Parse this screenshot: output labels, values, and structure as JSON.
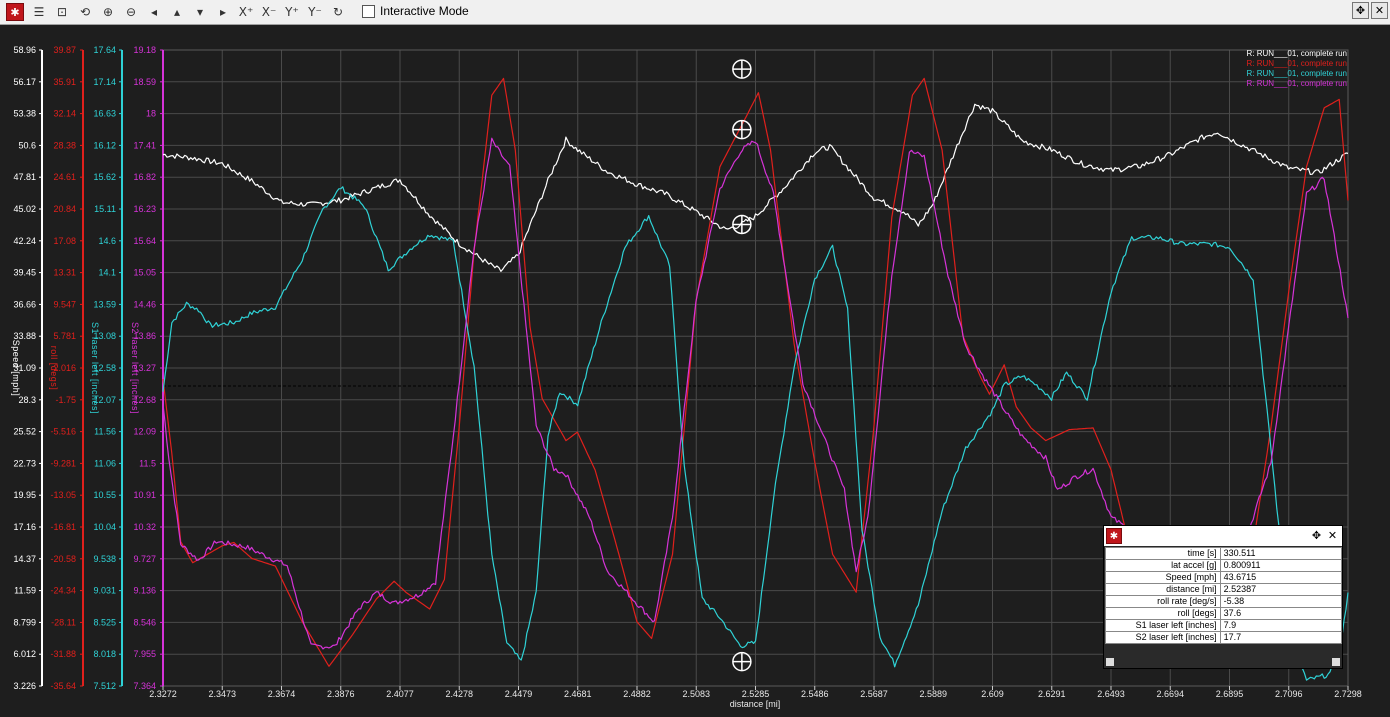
{
  "toolbar": {
    "interactive_mode_label": "Interactive Mode",
    "buttons": [
      "settings-icon",
      "checklist-icon",
      "zoom-window-icon",
      "zoom-fit-icon",
      "zoom-in-icon",
      "zoom-out-icon",
      "pan-left-icon",
      "pan-up-icon",
      "pan-down-icon",
      "pan-right-icon",
      "add-x-cursor-icon",
      "remove-x-cursor-icon",
      "add-y-cursor-icon",
      "remove-y-cursor-icon",
      "refresh-icon"
    ]
  },
  "colors": {
    "speed": "#ffffff",
    "roll": "#e0201c",
    "s1": "#2fd2d6",
    "s2": "#d633d8",
    "grid": "#4a4a4a",
    "bg": "#1e1e1e"
  },
  "chart_data": {
    "type": "line",
    "xlabel": "distance [mi]",
    "x_ticks": [
      "2.3272",
      "2.3473",
      "2.3674",
      "2.3876",
      "2.4077",
      "2.4278",
      "2.4479",
      "2.4681",
      "2.4882",
      "2.5083",
      "2.5285",
      "2.5486",
      "2.5687",
      "2.5889",
      "2.609",
      "2.6291",
      "2.6493",
      "2.6694",
      "2.6895",
      "2.7096",
      "2.7298"
    ],
    "xlim": [
      2.3272,
      2.7298
    ],
    "cursor_x": 2.52387,
    "legend": [
      "R:  RUN___01, complete run",
      "R:  RUN___01, complete run",
      "R:  RUN___01, complete run",
      "R:  RUN___01, complete run"
    ],
    "axes": [
      {
        "id": "speed",
        "label": "Speed [mph]",
        "ylim": [
          3.226,
          58.96
        ],
        "ticks": [
          "58.96",
          "56.17",
          "53.38",
          "50.6",
          "47.81",
          "45.02",
          "42.24",
          "39.45",
          "36.66",
          "33.88",
          "31.09",
          "28.3",
          "25.52",
          "22.73",
          "19.95",
          "17.16",
          "14.37",
          "11.59",
          "8.799",
          "6.012",
          "3.226"
        ]
      },
      {
        "id": "roll",
        "label": "roll [degs]",
        "ylim": [
          -35.64,
          39.87
        ],
        "ticks": [
          "39.87",
          "35.91",
          "32.14",
          "28.38",
          "24.61",
          "20.84",
          "17.08",
          "13.31",
          "9.547",
          "5.781",
          "2.016",
          "-1.75",
          "-5.516",
          "-9.281",
          "-13.05",
          "-16.81",
          "-20.58",
          "-24.34",
          "-28.11",
          "-31.88",
          "-35.64"
        ]
      },
      {
        "id": "s1",
        "label": "S1 laser left [inches]",
        "ylim": [
          7.512,
          17.64
        ],
        "ticks": [
          "17.64",
          "17.14",
          "16.63",
          "16.12",
          "15.62",
          "15.11",
          "14.6",
          "14.1",
          "13.59",
          "13.08",
          "12.58",
          "12.07",
          "11.56",
          "11.06",
          "10.55",
          "10.04",
          "9.538",
          "9.031",
          "8.525",
          "8.018",
          "7.512"
        ]
      },
      {
        "id": "s2",
        "label": "S2 laser left [inches]",
        "ylim": [
          7.364,
          19.18
        ],
        "ticks": [
          "19.18",
          "18.59",
          "18",
          "17.41",
          "16.82",
          "16.23",
          "15.64",
          "15.05",
          "14.46",
          "13.86",
          "13.27",
          "12.68",
          "12.09",
          "11.5",
          "10.91",
          "10.32",
          "9.727",
          "9.136",
          "8.546",
          "7.955",
          "7.364"
        ]
      }
    ],
    "series": [
      {
        "name": "Speed [mph]",
        "axis": "speed",
        "noise": 0.25,
        "points": [
          [
            2.3272,
            49.8
          ],
          [
            2.3373,
            49.5
          ],
          [
            2.3473,
            49.0
          ],
          [
            2.3573,
            47.5
          ],
          [
            2.3674,
            45.6
          ],
          [
            2.3775,
            45.4
          ],
          [
            2.3876,
            45.8
          ],
          [
            2.4077,
            47.6
          ],
          [
            2.4178,
            44.5
          ],
          [
            2.4278,
            42.0
          ],
          [
            2.4379,
            40.2
          ],
          [
            2.442,
            39.6
          ],
          [
            2.4479,
            41.0
          ],
          [
            2.458,
            47.5
          ],
          [
            2.4641,
            51.1
          ],
          [
            2.4681,
            50.2
          ],
          [
            2.4782,
            48.3
          ],
          [
            2.4882,
            47.2
          ],
          [
            2.4983,
            46.3
          ],
          [
            2.5083,
            44.8
          ],
          [
            2.5184,
            43.2
          ],
          [
            2.5239,
            43.7
          ],
          [
            2.5285,
            44.4
          ],
          [
            2.5386,
            47.0
          ],
          [
            2.5486,
            50.0
          ],
          [
            2.5537,
            50.5
          ],
          [
            2.5587,
            49.0
          ],
          [
            2.5687,
            46.0
          ],
          [
            2.5788,
            44.8
          ],
          [
            2.5838,
            43.6
          ],
          [
            2.5889,
            45.5
          ],
          [
            2.599,
            51.8
          ],
          [
            2.603,
            54.2
          ],
          [
            2.609,
            53.6
          ],
          [
            2.6191,
            51.0
          ],
          [
            2.6291,
            50.2
          ],
          [
            2.6392,
            49.0
          ],
          [
            2.6493,
            48.4
          ],
          [
            2.6593,
            48.8
          ],
          [
            2.6694,
            49.8
          ],
          [
            2.6795,
            51.2
          ],
          [
            2.6855,
            51.8
          ],
          [
            2.6895,
            51.2
          ],
          [
            2.7096,
            48.6
          ],
          [
            2.7197,
            48.2
          ],
          [
            2.7298,
            49.9
          ]
        ]
      },
      {
        "name": "roll [degs]",
        "axis": "roll",
        "noise": 0,
        "points": [
          [
            2.3272,
            0.8
          ],
          [
            2.3302,
            -8
          ],
          [
            2.3332,
            -18.5
          ],
          [
            2.3373,
            -21.0
          ],
          [
            2.3473,
            -19.0
          ],
          [
            2.3513,
            -18.6
          ],
          [
            2.3574,
            -20.5
          ],
          [
            2.3654,
            -21.4
          ],
          [
            2.3745,
            -28.0
          ],
          [
            2.3836,
            -33.3
          ],
          [
            2.3917,
            -29.5
          ],
          [
            2.3997,
            -25.3
          ],
          [
            2.4057,
            -23.2
          ],
          [
            2.4097,
            -24.5
          ],
          [
            2.4178,
            -26.5
          ],
          [
            2.4228,
            -23.0
          ],
          [
            2.4278,
            -5.0
          ],
          [
            2.4329,
            16.0
          ],
          [
            2.4389,
            34.5
          ],
          [
            2.4429,
            36.5
          ],
          [
            2.4469,
            28.0
          ],
          [
            2.4519,
            7.0
          ],
          [
            2.456,
            -1.5
          ],
          [
            2.4641,
            -6.5
          ],
          [
            2.468,
            -5.5
          ],
          [
            2.474,
            -10.0
          ],
          [
            2.4821,
            -20.0
          ],
          [
            2.4882,
            -28.0
          ],
          [
            2.4932,
            -30.0
          ],
          [
            2.5003,
            -20.0
          ],
          [
            2.5083,
            10.0
          ],
          [
            2.5164,
            26.0
          ],
          [
            2.5254,
            32.0
          ],
          [
            2.5295,
            34.8
          ],
          [
            2.5336,
            28.0
          ],
          [
            2.5416,
            5.0
          ],
          [
            2.5486,
            -9.0
          ],
          [
            2.5547,
            -20.0
          ],
          [
            2.5627,
            -24.5
          ],
          [
            2.5687,
            -5.0
          ],
          [
            2.5748,
            20.0
          ],
          [
            2.5818,
            34.5
          ],
          [
            2.5858,
            36.5
          ],
          [
            2.5919,
            28.0
          ],
          [
            2.5989,
            6.0
          ],
          [
            2.605,
            1.0
          ],
          [
            2.608,
            -1.0
          ],
          [
            2.613,
            2.5
          ],
          [
            2.6171,
            -2.5
          ],
          [
            2.6221,
            -5.0
          ],
          [
            2.6271,
            -6.5
          ],
          [
            2.6351,
            -5.2
          ],
          [
            2.6432,
            -5.0
          ],
          [
            2.6493,
            -10.0
          ],
          [
            2.6573,
            -21.5
          ],
          [
            2.6674,
            -28.0
          ],
          [
            2.6775,
            -32.0
          ],
          [
            2.6855,
            -33.0
          ],
          [
            2.6936,
            -28.0
          ],
          [
            2.7036,
            -5.0
          ],
          [
            2.7096,
            11.0
          ],
          [
            2.7157,
            26.0
          ],
          [
            2.7217,
            33.0
          ],
          [
            2.7268,
            34.0
          ],
          [
            2.7298,
            22.0
          ]
        ]
      },
      {
        "name": "S1 laser left [inches]",
        "axis": "s1",
        "noise": 0.04,
        "points": [
          [
            2.3272,
            12.2
          ],
          [
            2.3302,
            13.3
          ],
          [
            2.3352,
            13.6
          ],
          [
            2.3393,
            13.5
          ],
          [
            2.3433,
            13.25
          ],
          [
            2.3513,
            13.3
          ],
          [
            2.3574,
            13.45
          ],
          [
            2.3654,
            13.55
          ],
          [
            2.3745,
            14.3
          ],
          [
            2.3815,
            15.1
          ],
          [
            2.3876,
            15.45
          ],
          [
            2.3957,
            15.15
          ],
          [
            2.4037,
            14.15
          ],
          [
            2.4118,
            14.5
          ],
          [
            2.4178,
            14.7
          ],
          [
            2.4258,
            14.6
          ],
          [
            2.4329,
            12.6
          ],
          [
            2.4389,
            9.6
          ],
          [
            2.444,
            8.2
          ],
          [
            2.4489,
            7.9
          ],
          [
            2.454,
            9.0
          ],
          [
            2.458,
            11.5
          ],
          [
            2.462,
            12.2
          ],
          [
            2.4681,
            12.0
          ],
          [
            2.4761,
            13.3
          ],
          [
            2.4842,
            14.5
          ],
          [
            2.4922,
            15.0
          ],
          [
            2.4993,
            14.2
          ],
          [
            2.5043,
            11.0
          ],
          [
            2.5104,
            8.9
          ],
          [
            2.5164,
            8.6
          ],
          [
            2.5234,
            8.15
          ],
          [
            2.5285,
            8.2
          ],
          [
            2.5346,
            10.5
          ],
          [
            2.5416,
            12.6
          ],
          [
            2.5486,
            14.0
          ],
          [
            2.5547,
            14.5
          ],
          [
            2.5598,
            13.5
          ],
          [
            2.5647,
            10.0
          ],
          [
            2.5708,
            8.3
          ],
          [
            2.5758,
            7.85
          ],
          [
            2.5838,
            8.8
          ],
          [
            2.5919,
            10.3
          ],
          [
            2.5999,
            11.3
          ],
          [
            2.609,
            11.9
          ],
          [
            2.613,
            12.3
          ],
          [
            2.6191,
            12.45
          ],
          [
            2.6241,
            12.3
          ],
          [
            2.6291,
            12.1
          ],
          [
            2.6342,
            12.5
          ],
          [
            2.6412,
            12.1
          ],
          [
            2.6493,
            13.8
          ],
          [
            2.6563,
            14.65
          ],
          [
            2.6654,
            14.65
          ],
          [
            2.6734,
            14.55
          ],
          [
            2.6835,
            14.55
          ],
          [
            2.6896,
            14.5
          ],
          [
            2.6976,
            14.0
          ],
          [
            2.7036,
            11.3
          ],
          [
            2.7096,
            8.5
          ],
          [
            2.7157,
            7.6
          ],
          [
            2.7237,
            7.7
          ],
          [
            2.7278,
            8.3
          ],
          [
            2.7298,
            9.0
          ]
        ]
      },
      {
        "name": "S2 laser left [inches]",
        "axis": "s2",
        "noise": 0.05,
        "points": [
          [
            2.3272,
            12.6
          ],
          [
            2.3292,
            11.6
          ],
          [
            2.3332,
            10.0
          ],
          [
            2.3393,
            9.7
          ],
          [
            2.3453,
            10.05
          ],
          [
            2.3553,
            9.95
          ],
          [
            2.3614,
            9.8
          ],
          [
            2.3694,
            9.6
          ],
          [
            2.3775,
            8.1
          ],
          [
            2.3856,
            8.1
          ],
          [
            2.3937,
            8.8
          ],
          [
            2.3997,
            9.1
          ],
          [
            2.4057,
            8.9
          ],
          [
            2.4138,
            9.05
          ],
          [
            2.4198,
            9.3
          ],
          [
            2.4258,
            12.0
          ],
          [
            2.4329,
            15.5
          ],
          [
            2.4389,
            17.5
          ],
          [
            2.445,
            17.0
          ],
          [
            2.454,
            12.2
          ],
          [
            2.46,
            11.4
          ],
          [
            2.4641,
            11.3
          ],
          [
            2.4721,
            10.5
          ],
          [
            2.4782,
            9.5
          ],
          [
            2.4882,
            8.9
          ],
          [
            2.4942,
            8.55
          ],
          [
            2.5003,
            10.5
          ],
          [
            2.5083,
            14.5
          ],
          [
            2.5164,
            16.6
          ],
          [
            2.5234,
            17.3
          ],
          [
            2.5285,
            17.5
          ],
          [
            2.5346,
            16.5
          ],
          [
            2.5446,
            13.0
          ],
          [
            2.5516,
            12.0
          ],
          [
            2.5587,
            11.0
          ],
          [
            2.5627,
            9.5
          ],
          [
            2.5667,
            10.5
          ],
          [
            2.5748,
            15.0
          ],
          [
            2.5808,
            17.3
          ],
          [
            2.5858,
            17.2
          ],
          [
            2.5939,
            15.0
          ],
          [
            2.5999,
            13.7
          ],
          [
            2.605,
            13.2
          ],
          [
            2.613,
            12.5
          ],
          [
            2.6191,
            12.0
          ],
          [
            2.6271,
            11.6
          ],
          [
            2.6311,
            11.0
          ],
          [
            2.6372,
            11.25
          ],
          [
            2.6432,
            11.4
          ],
          [
            2.6493,
            10.5
          ],
          [
            2.6573,
            10.2
          ],
          [
            2.6674,
            9.8
          ],
          [
            2.6775,
            9.45
          ],
          [
            2.6855,
            9.15
          ],
          [
            2.6916,
            9.5
          ],
          [
            2.6976,
            10.5
          ],
          [
            2.7036,
            11.5
          ],
          [
            2.7096,
            14.0
          ],
          [
            2.7157,
            16.5
          ],
          [
            2.7217,
            16.8
          ],
          [
            2.7258,
            15.5
          ],
          [
            2.7298,
            14.2
          ]
        ]
      }
    ],
    "cursor_markers": [
      {
        "axis": "roll",
        "value": 37.6
      },
      {
        "axis": "s2",
        "value": 17.7
      },
      {
        "axis": "speed",
        "value": 43.6715
      },
      {
        "axis": "s1",
        "value": 7.9
      }
    ]
  },
  "popup": {
    "rows": [
      {
        "key": "time [s]",
        "value": "330.511"
      },
      {
        "key": "lat accel [g]",
        "value": "0.800911"
      },
      {
        "key": "Speed [mph]",
        "value": "43.6715"
      },
      {
        "key": "distance [mi]",
        "value": "2.52387"
      },
      {
        "key": "roll rate [deg/s]",
        "value": "-5.38"
      },
      {
        "key": "roll [degs]",
        "value": "37.6"
      },
      {
        "key": "S1 laser left [inches]",
        "value": "7.9"
      },
      {
        "key": "S2 laser left [inches]",
        "value": "17.7"
      }
    ]
  }
}
